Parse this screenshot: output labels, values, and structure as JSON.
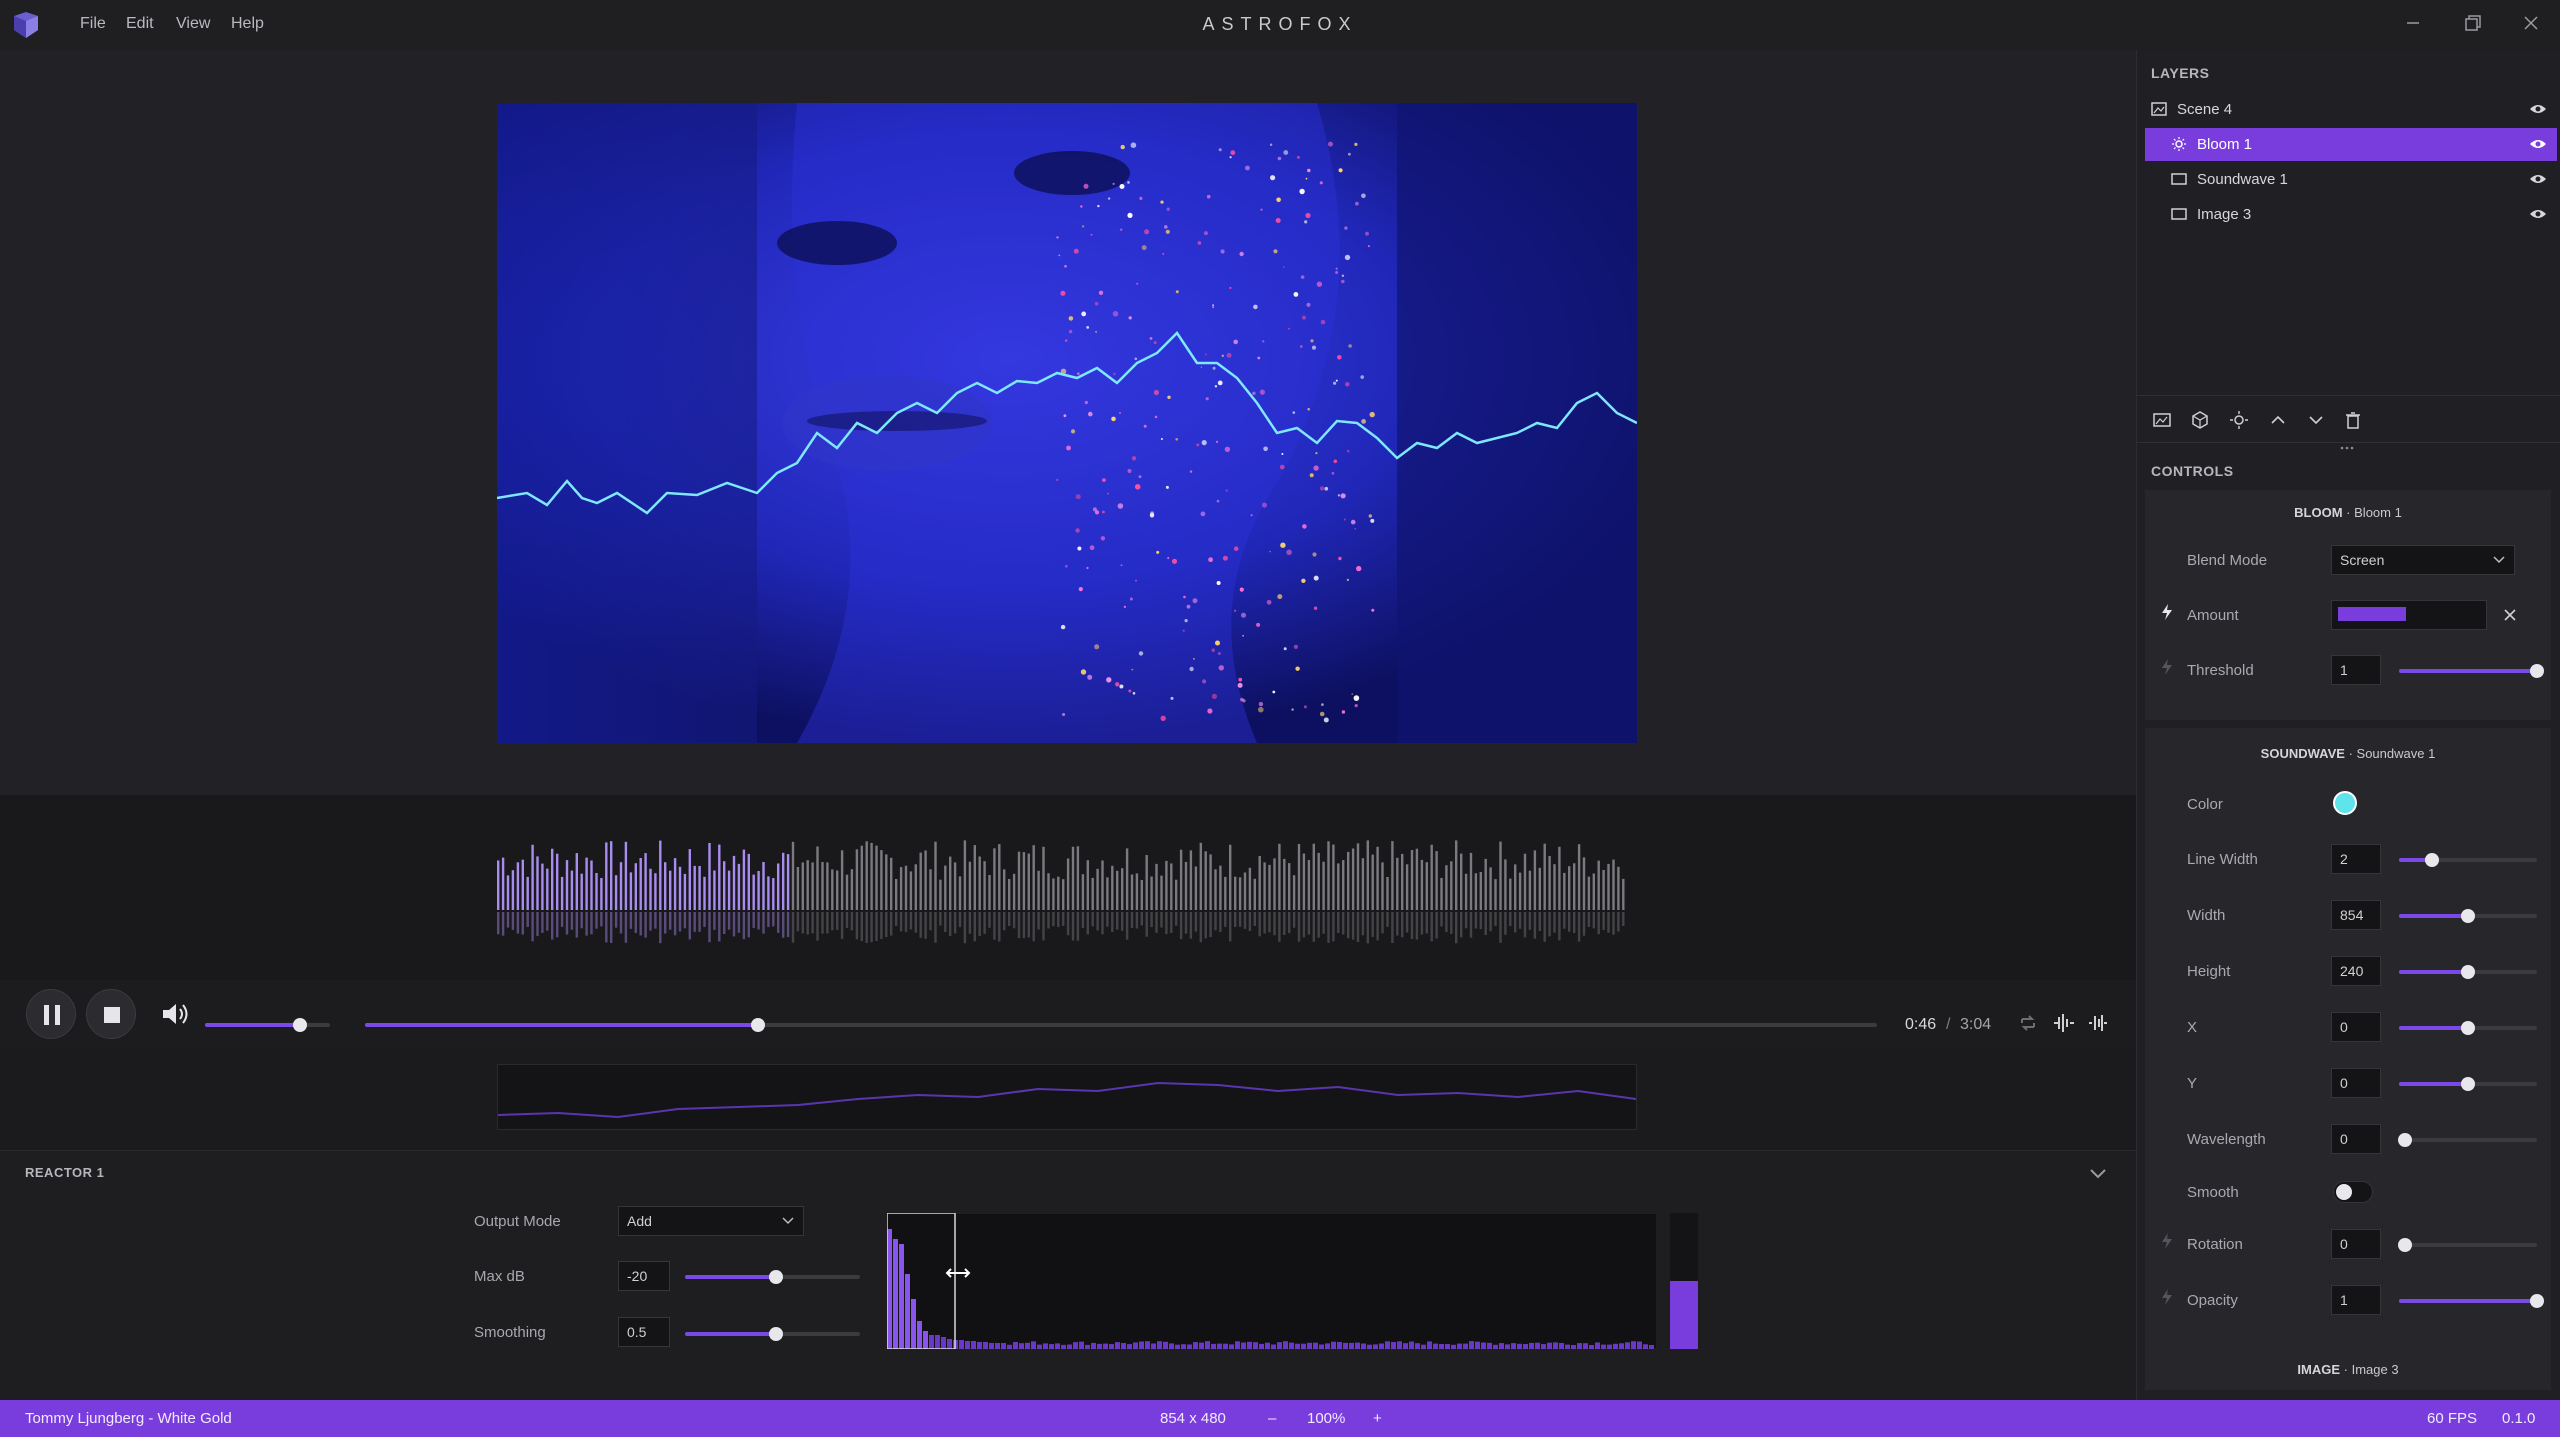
{
  "app": {
    "title": "ASTROFOX",
    "menu": [
      "File",
      "Edit",
      "View",
      "Help"
    ]
  },
  "colors": {
    "accent": "#7a3ddd",
    "soundwave_color": "#5ee4ea"
  },
  "player": {
    "current_time": "0:46",
    "total_time": "3:04",
    "time_separator": "/",
    "volume": 0.76,
    "progress": 0.26
  },
  "reactor": {
    "title": "REACTOR 1",
    "output_mode_label": "Output Mode",
    "output_mode_value": "Add",
    "max_db_label": "Max dB",
    "max_db_value": "-20",
    "max_db_level": 0.52,
    "smoothing_label": "Smoothing",
    "smoothing_value": "0.5",
    "smoothing_level": 0.52
  },
  "status": {
    "track": "Tommy Ljungberg - White Gold",
    "resolution": "854 x 480",
    "zoom_minus": "–",
    "zoom": "100%",
    "zoom_plus": "+",
    "fps": "60 FPS",
    "version": "0.1.0"
  },
  "layers": {
    "title": "LAYERS",
    "items": [
      {
        "label": "Scene 4",
        "icon": "image-icon"
      },
      {
        "label": "Bloom 1",
        "icon": "sun-icon"
      },
      {
        "label": "Soundwave 1",
        "icon": "rect-icon"
      },
      {
        "label": "Image 3",
        "icon": "rect-icon"
      }
    ]
  },
  "controls": {
    "title": "CONTROLS",
    "bloom": {
      "type": "BLOOM",
      "dot": "·",
      "name": "Bloom 1",
      "blend_mode_label": "Blend Mode",
      "blend_mode_value": "Screen",
      "amount_label": "Amount",
      "threshold_label": "Threshold",
      "threshold_value": "1"
    },
    "soundwave": {
      "type": "SOUNDWAVE",
      "dot": "·",
      "name": "Soundwave 1",
      "color_label": "Color",
      "line_width_label": "Line Width",
      "line_width_value": "2",
      "width_label": "Width",
      "width_value": "854",
      "height_label": "Height",
      "height_value": "240",
      "x_label": "X",
      "x_value": "0",
      "y_label": "Y",
      "y_value": "0",
      "wavelength_label": "Wavelength",
      "wavelength_value": "0",
      "smooth_label": "Smooth",
      "rotation_label": "Rotation",
      "rotation_value": "0",
      "opacity_label": "Opacity",
      "opacity_value": "1"
    },
    "image": {
      "type": "IMAGE",
      "dot": "·",
      "name": "Image 3"
    }
  }
}
